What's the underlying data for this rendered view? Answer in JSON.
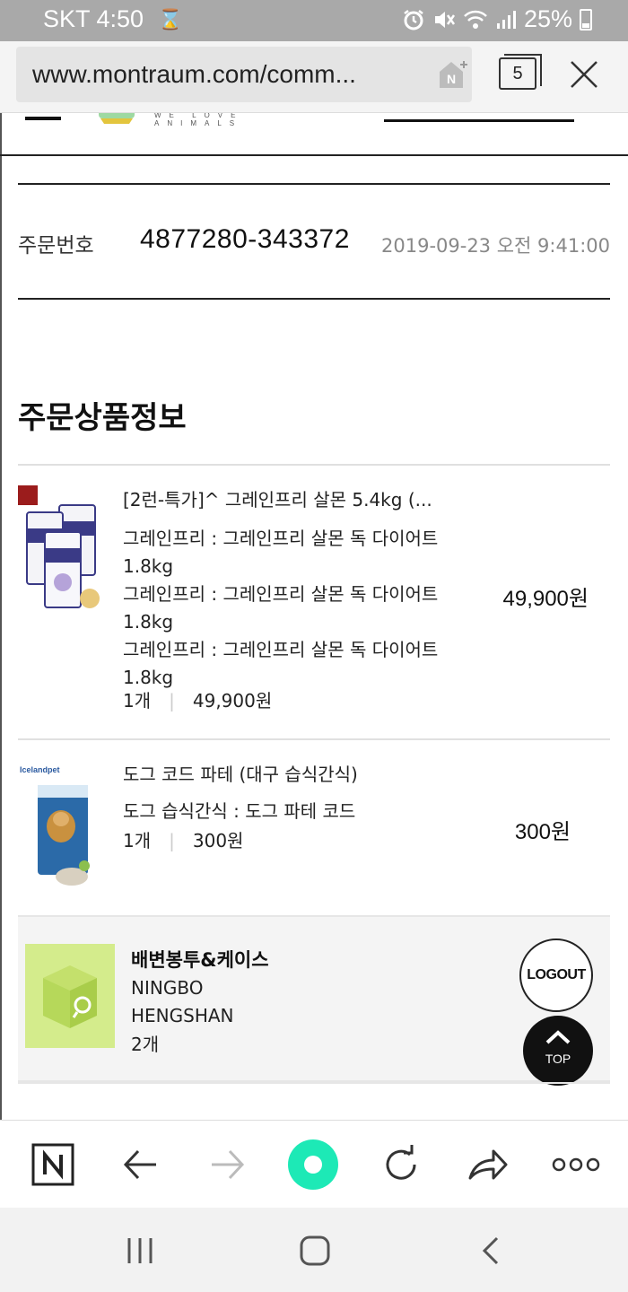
{
  "status_bar": {
    "carrier_time": "SKT 4:50",
    "hourglass": "⌛",
    "battery_percent": "25%",
    "icons": [
      "hourglass-icon",
      "alarm-icon",
      "mute-icon",
      "wifi-icon",
      "signal-icon",
      "battery-icon"
    ]
  },
  "browser": {
    "url": "www.montraum.com/comm...",
    "home_badge": "N",
    "tab_count": "5"
  },
  "order": {
    "label": "주문번호",
    "number": "4877280-343372",
    "datetime": "2019-09-23 오전 9:41:00"
  },
  "section_title": "주문상품정보",
  "items": [
    {
      "name": "[2런-특가]^ 그레인프리 살몬 5.4kg (...",
      "options": [
        "그레인프리 : 그레인프리 살몬 독 다이어트 1.8kg",
        "그레인프리 : 그레인프리 살몬 독 다이어트 1.8kg",
        "그레인프리 : 그레인프리 살몬 독 다이어트 1.8kg"
      ],
      "qty": "1개",
      "unit_price": "49,900원",
      "price": "49,900원"
    },
    {
      "brand_tag": "Icelandpet",
      "name": "도그 코드 파테 (대구 습식간식)",
      "options": [
        "도그 습식간식 : 도그 파테 코드"
      ],
      "qty": "1개",
      "unit_price": "300원",
      "price": "300원"
    }
  ],
  "gift": {
    "name": "배변봉투&케이스",
    "brand_line1": "NINGBO",
    "brand_line2": "HENGSHAN",
    "qty": "2개"
  },
  "floating": {
    "logout": "LOGOUT",
    "top": "TOP"
  },
  "logo_tagline": "WE LOVE ANIMALS",
  "colors": {
    "status_bar": "#a9a9a9",
    "accent_green": "#1de9b6",
    "gift_thumb": "#d4ec8c"
  }
}
